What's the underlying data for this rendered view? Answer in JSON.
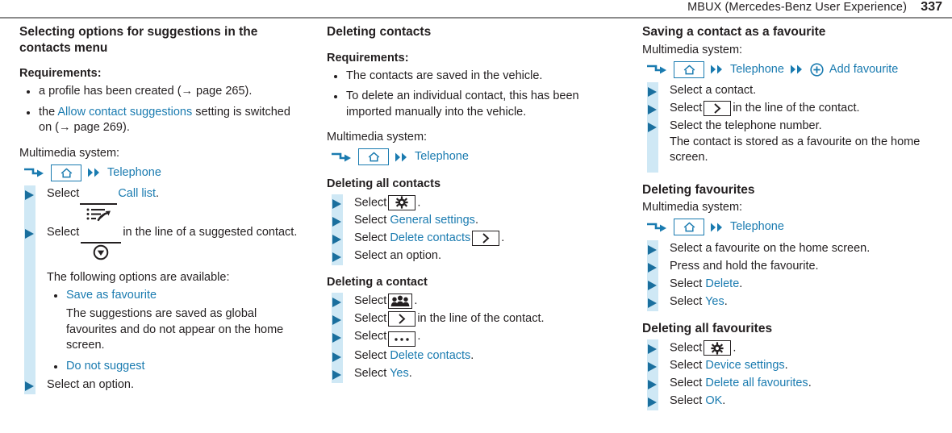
{
  "header": {
    "title": "MBUX (Mercedes-Benz User Experience)",
    "page_number": "337"
  },
  "colors": {
    "link": "#1a7bb0",
    "arrow": "#1a6f9e",
    "band": "#cfe8f5",
    "text": "#231f20",
    "rule": "#8c8c8c"
  },
  "icons": {
    "step_arrow": "triangle-right-icon",
    "nav_arrow": "stepped-arrow-icon",
    "home": "home-icon",
    "double_chevron": "double-chevron-right-icon",
    "plus_circle": "plus-circle-icon",
    "call_list": "call-list-icon",
    "dropdown": "circle-down-arrow-icon",
    "gear": "gear-icon",
    "chevron": "chevron-right-icon",
    "ellipsis": "ellipsis-icon",
    "contacts": "contacts-group-icon"
  },
  "column1": {
    "title": "Selecting options for suggestions in the contacts menu",
    "requirements_label": "Requirements:",
    "requirements": [
      "a profile has been created (→ page 265).",
      "the Allow contact suggestions setting is switched on (→ page 269)."
    ],
    "req1_plain": "a profile has been created (→ page 265).",
    "req2_pre": "the ",
    "req2_link": "Allow contact suggestions",
    "req2_post": " setting is switched on (→ page 269).",
    "multimedia_label": "Multimedia system:",
    "nav_path": "Telephone",
    "steps": {
      "select_call_list_pre": "Select",
      "select_call_list_link": "Call list",
      "select_call_list_post": ".",
      "select_dropdown_pre": "Select",
      "select_dropdown_post": "in the line of a suggested contact.",
      "options_intro": "The following options are available:",
      "option_1": "Save as favourite",
      "option_1_desc": "The suggestions are saved as global favourites and do not appear on the home screen.",
      "option_2": "Do not suggest",
      "select_option": "Select an option."
    }
  },
  "column2": {
    "title": "Deleting contacts",
    "requirements_label": "Requirements:",
    "requirements": [
      "The contacts are saved in the vehicle.",
      "To delete an individual contact, this has been imported manually into the vehicle."
    ],
    "multimedia_label": "Multimedia system:",
    "nav_path": "Telephone",
    "deleting_all": {
      "title": "Deleting all contacts",
      "step_gear_pre": "Select",
      "step_gear_post": ".",
      "step_general_pre": "Select ",
      "step_general_link": "General settings",
      "step_general_post": ".",
      "step_delete_pre": "Select ",
      "step_delete_link": "Delete contacts",
      "step_delete_post": ".",
      "step_option": "Select an option."
    },
    "deleting_one": {
      "title": "Deleting a contact",
      "step_contacts_pre": "Select",
      "step_contacts_post": ".",
      "step_chevron_pre": "Select",
      "step_chevron_post": "in the line of the contact.",
      "step_ellipsis_pre": "Select",
      "step_ellipsis_post": ".",
      "step_delete_pre": "Select ",
      "step_delete_link": "Delete contacts",
      "step_delete_post": ".",
      "step_yes_pre": "Select ",
      "step_yes_link": "Yes",
      "step_yes_post": "."
    }
  },
  "column3": {
    "saving": {
      "title": "Saving a contact as a favourite",
      "multimedia_label": "Multimedia system:",
      "nav_path_1": "Telephone",
      "nav_path_2": "Add favourite",
      "step_contact": "Select a contact.",
      "step_chevron_pre": "Select",
      "step_chevron_post": "in the line of the contact.",
      "step_number": "Select the telephone number.",
      "step_number_note": "The contact is stored as a favourite on the home screen."
    },
    "deleting_fav": {
      "title": "Deleting favourites",
      "multimedia_label": "Multimedia system:",
      "nav_path": "Telephone",
      "step_select_fav": "Select a favourite on the home screen.",
      "step_press_hold": "Press and hold the favourite.",
      "step_delete_pre": "Select ",
      "step_delete_link": "Delete",
      "step_delete_post": ".",
      "step_yes_pre": "Select ",
      "step_yes_link": "Yes",
      "step_yes_post": "."
    },
    "deleting_all_fav": {
      "title": "Deleting all favourites",
      "step_gear_pre": "Select",
      "step_gear_post": ".",
      "step_device_pre": "Select ",
      "step_device_link": "Device settings",
      "step_device_post": ".",
      "step_delall_pre": "Select ",
      "step_delall_link": "Delete all favourites",
      "step_delall_post": ".",
      "step_ok_pre": "Select ",
      "step_ok_link": "OK",
      "step_ok_post": "."
    }
  }
}
